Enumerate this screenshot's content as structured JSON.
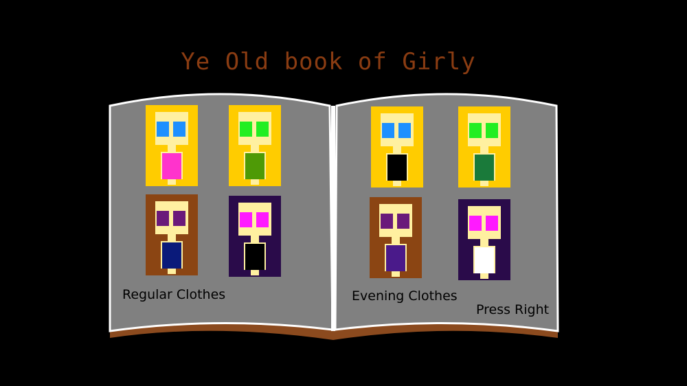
{
  "title": "Ye Old book of Girly",
  "left_page": {
    "label": "Regular Clothes",
    "outfits": [
      {
        "hair": "blonde",
        "eyes": "blue",
        "dress": "pink top"
      },
      {
        "hair": "blonde",
        "eyes": "green",
        "dress": "green bikini"
      },
      {
        "hair": "brown",
        "eyes": "purple",
        "dress": "navy dress"
      },
      {
        "hair": "dark purple",
        "eyes": "magenta",
        "dress": "black dress"
      }
    ]
  },
  "right_page": {
    "label": "Evening Clothes",
    "outfits": [
      {
        "hair": "blonde",
        "eyes": "blue",
        "dress": "black gown"
      },
      {
        "hair": "blonde",
        "eyes": "green",
        "dress": "green dress"
      },
      {
        "hair": "brown",
        "eyes": "purple",
        "dress": "purple gown"
      },
      {
        "hair": "dark purple",
        "eyes": "magenta",
        "dress": "white gown"
      }
    ]
  },
  "prompt": "Press Right",
  "colors": {
    "background": "#000000",
    "page": "#808080",
    "page_edge": "#ffffff",
    "book_base": "#8b4a1e",
    "title": "#8a3c12",
    "hair_blonde": "#ffcc00",
    "hair_brown": "#8b4513",
    "hair_dark": "#2a0b4a",
    "skin": "#fff0a0"
  }
}
